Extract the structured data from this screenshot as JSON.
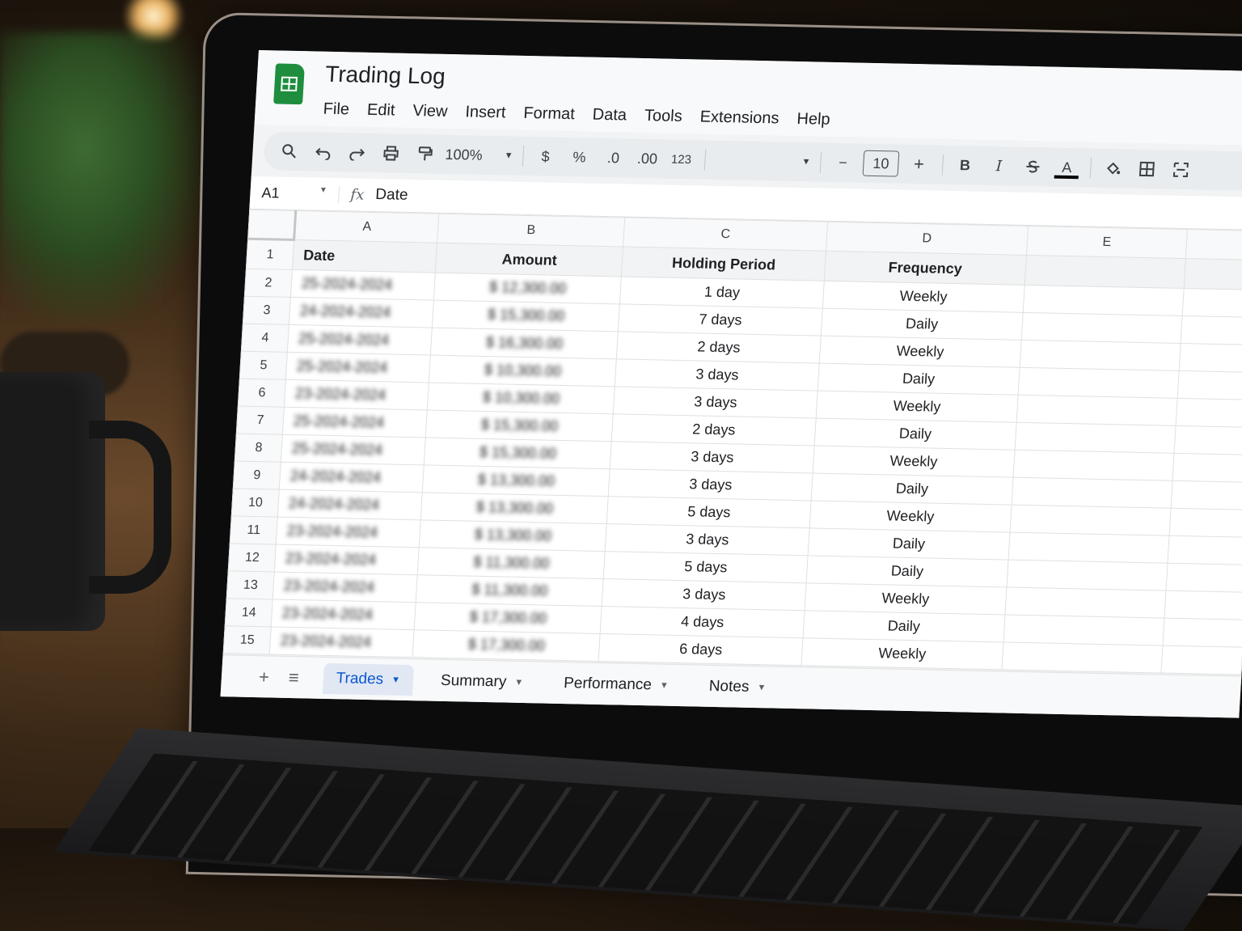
{
  "app": {
    "title": "Trading Log",
    "menu": [
      "File",
      "Edit",
      "View",
      "Insert",
      "Format",
      "Data",
      "Tools",
      "Extensions",
      "Help"
    ]
  },
  "toolbar": {
    "zoom": "100%",
    "currency": "$",
    "percent": "%",
    "decrease_decimal": ".0",
    "increase_decimal": ".00",
    "number_format": "123",
    "font_size": "10",
    "minus": "−",
    "plus": "+",
    "bold": "B",
    "italic": "I",
    "text_color": "A"
  },
  "formula_bar": {
    "cell_ref": "A1",
    "fx": "fx",
    "value": "Date"
  },
  "grid": {
    "columns": [
      "A",
      "B",
      "C",
      "D",
      "E"
    ],
    "header": [
      "Date",
      "Amount",
      "Holding Period",
      "Frequency"
    ],
    "rows": [
      {
        "n": "2",
        "date": "25-2024-2024",
        "amount": "$ 12,300.00",
        "period": "1 day",
        "freq": "Weekly"
      },
      {
        "n": "3",
        "date": "24-2024-2024",
        "amount": "$ 15,300.00",
        "period": "7 days",
        "freq": "Daily"
      },
      {
        "n": "4",
        "date": "25-2024-2024",
        "amount": "$ 16,300.00",
        "period": "2 days",
        "freq": "Weekly"
      },
      {
        "n": "5",
        "date": "25-2024-2024",
        "amount": "$ 10,300.00",
        "period": "3 days",
        "freq": "Daily"
      },
      {
        "n": "6",
        "date": "23-2024-2024",
        "amount": "$ 10,300.00",
        "period": "3 days",
        "freq": "Weekly"
      },
      {
        "n": "7",
        "date": "25-2024-2024",
        "amount": "$ 15,300.00",
        "period": "2 days",
        "freq": "Daily"
      },
      {
        "n": "8",
        "date": "25-2024-2024",
        "amount": "$ 15,300.00",
        "period": "3 days",
        "freq": "Weekly"
      },
      {
        "n": "9",
        "date": "24-2024-2024",
        "amount": "$ 13,300.00",
        "period": "3 days",
        "freq": "Daily"
      },
      {
        "n": "10",
        "date": "24-2024-2024",
        "amount": "$ 13,300.00",
        "period": "5 days",
        "freq": "Weekly"
      },
      {
        "n": "11",
        "date": "23-2024-2024",
        "amount": "$ 13,300.00",
        "period": "3 days",
        "freq": "Daily"
      },
      {
        "n": "12",
        "date": "23-2024-2024",
        "amount": "$ 11,300.00",
        "period": "5 days",
        "freq": "Daily"
      },
      {
        "n": "13",
        "date": "23-2024-2024",
        "amount": "$ 11,300.00",
        "period": "3 days",
        "freq": "Weekly"
      },
      {
        "n": "14",
        "date": "23-2024-2024",
        "amount": "$ 17,300.00",
        "period": "4 days",
        "freq": "Daily"
      },
      {
        "n": "15",
        "date": "23-2024-2024",
        "amount": "$ 17,300.00",
        "period": "6 days",
        "freq": "Weekly"
      }
    ]
  },
  "sheet_tabs": {
    "add": "+",
    "all_sheets": "≡",
    "tabs": [
      "Trades",
      "Summary",
      "Performance",
      "Notes"
    ]
  },
  "colors": {
    "sheets_green": "#1e8e3e",
    "active_tab_blue": "#0b57d0"
  }
}
